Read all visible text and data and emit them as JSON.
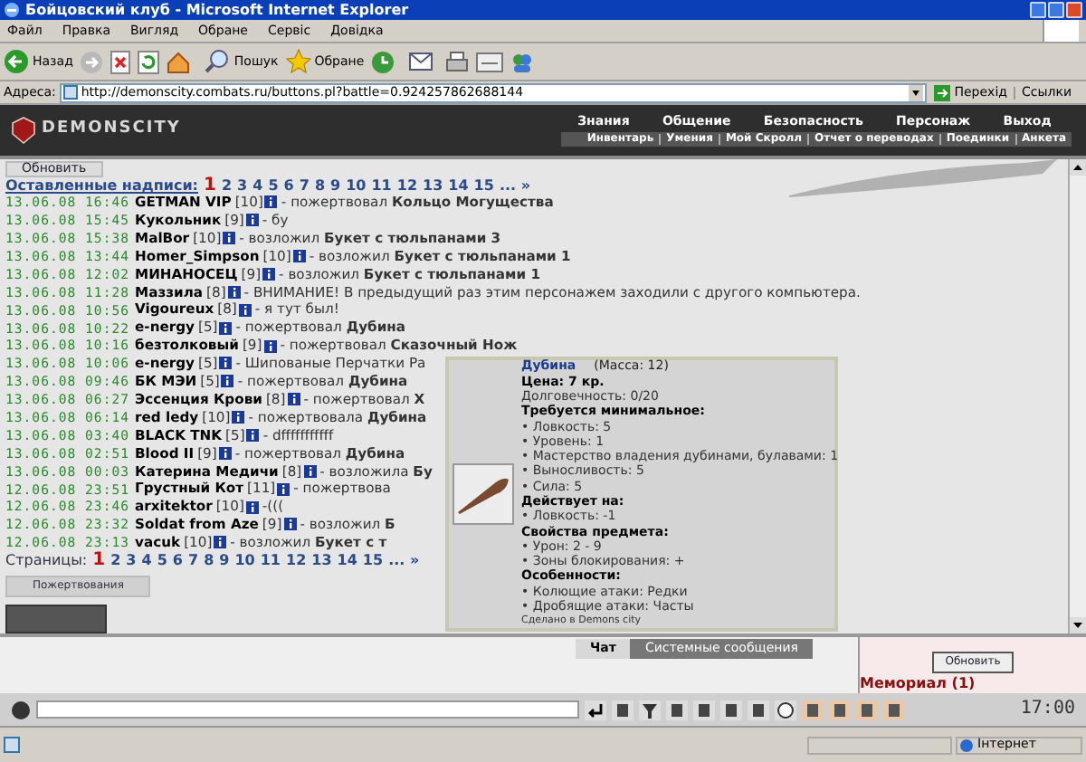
{
  "window": {
    "title": "Бойцовский клуб - Microsoft Internet Explorer"
  },
  "menu": [
    "Файл",
    "Правка",
    "Вигляд",
    "Обране",
    "Сервіс",
    "Довідка"
  ],
  "toolbar": {
    "back": "Назад",
    "search": "Пошук",
    "favorites": "Обране"
  },
  "address_bar": {
    "label": "Адреса:",
    "url": "http://demonscity.combats.ru/buttons.pl?battle=0.924257862688144",
    "go": "Перехід",
    "links": "Ссылки"
  },
  "site_header": {
    "logo": "DEMONSCITY",
    "nav_top": [
      "Знания",
      "Общение",
      "Безопасность",
      "Персонаж",
      "Выход"
    ],
    "nav_bottom": [
      "Инвентарь",
      "Умения",
      "Мой Скролл",
      "Отчет о переводах",
      "Поединки",
      "Анкета"
    ]
  },
  "refresh_button": "Обновить",
  "pager_top": {
    "label": "Оставленные надписи:",
    "pages": [
      {
        "label": "1",
        "selected": true
      },
      {
        "label": "2",
        "selected": false
      },
      {
        "label": "3",
        "selected": false
      },
      {
        "label": "4",
        "selected": false
      },
      {
        "label": "5",
        "selected": false
      },
      {
        "label": "6",
        "selected": false
      },
      {
        "label": "7",
        "selected": false
      },
      {
        "label": "8",
        "selected": false
      },
      {
        "label": "9",
        "selected": false
      },
      {
        "label": "10",
        "selected": false
      },
      {
        "label": "11",
        "selected": false
      },
      {
        "label": "12",
        "selected": false
      },
      {
        "label": "13",
        "selected": false
      },
      {
        "label": "14",
        "selected": false
      },
      {
        "label": "15",
        "selected": false
      }
    ],
    "more": "... »"
  },
  "rows": [
    {
      "time": "13.06.08 16:46",
      "nick": "GETMAN VIP",
      "level": "[10]",
      "message": "- пожертвовал **Кольцо Могущества**"
    },
    {
      "time": "13.06.08 15:45",
      "nick": "Кукольник",
      "level": "[9]",
      "message": "- бу"
    },
    {
      "time": "13.06.08 15:38",
      "nick": "MalBor",
      "level": "[10]",
      "message": "- возложил **Букет с тюльпанами 3**"
    },
    {
      "time": "13.06.08 13:44",
      "nick": "Homer_Simpson",
      "level": "[10]",
      "message": "- возложил **Букет с тюльпанами 1**"
    },
    {
      "time": "13.06.08 12:02",
      "nick": "МИНАНОСЕЦ",
      "level": "[9]",
      "message": "- возложил **Букет с тюльпанами 1**"
    },
    {
      "time": "13.06.08 11:28",
      "nick": "Маззила",
      "level": "[8]",
      "message": "- ВНИМАНИЕ! В предыдущий раз этим персонажем заходили с другого компьютера."
    },
    {
      "time": "13.06.08 10:56",
      "nick": "Vigoureux",
      "level": "[8]",
      "message": "- я тут был!"
    },
    {
      "time": "13.06.08 10:22",
      "nick": "e-nergy",
      "level": "[5]",
      "message": "- пожертвовал **Дубина**"
    },
    {
      "time": "13.06.08 10:16",
      "nick": "безтолковый",
      "level": "[9]",
      "message": "- пожертвовал **Сказочный Нож**"
    },
    {
      "time": "13.06.08 10:06",
      "nick": "e-nergy",
      "level": "[5]",
      "message": "- Шипованые Перчатки Ра"
    },
    {
      "time": "13.06.08 09:46",
      "nick": "БК МЭИ",
      "level": "[5]",
      "message": "- пожертвовал **Дубина**"
    },
    {
      "time": "13.06.08 06:27",
      "nick": "Эссенция Крови",
      "level": "[8]",
      "message": "- пожертвовал **Х**"
    },
    {
      "time": "13.06.08 06:14",
      "nick": "red ledy",
      "level": "[10]",
      "message": "- пожертвовала **Дубина**"
    },
    {
      "time": "13.06.08 03:40",
      "nick": "BLACK TNK",
      "level": "[5]",
      "message": "- dfffffffffff"
    },
    {
      "time": "13.06.08 02:51",
      "nick": "Blood II",
      "level": "[9]",
      "message": "- пожертвовал **Дубина**"
    },
    {
      "time": "13.06.08 00:03",
      "nick": "Катерина Медичи",
      "level": "[8]",
      "message": "- возложила **Бу**"
    },
    {
      "time": "12.06.08 23:51",
      "nick": "Грустный Кот",
      "level": "[11]",
      "message": "- пожертвова"
    },
    {
      "time": "12.06.08 23:46",
      "nick": "arxitektor",
      "level": "[10]",
      "message": "-((("
    },
    {
      "time": "12.06.08 23:32",
      "nick": "Soldat from Aze",
      "level": "[9]",
      "message": "- возложил **Б**"
    },
    {
      "time": "12.06.08 23:13",
      "nick": "vacuk",
      "level": "[10]",
      "message": "- возложил **Букет с т**"
    }
  ],
  "pager_bottom": {
    "label": "Страницы:",
    "pages": [
      {
        "label": "1",
        "selected": true
      },
      {
        "label": "2",
        "selected": false
      },
      {
        "label": "3",
        "selected": false
      },
      {
        "label": "4",
        "selected": false
      },
      {
        "label": "5",
        "selected": false
      },
      {
        "label": "6",
        "selected": false
      },
      {
        "label": "7",
        "selected": false
      },
      {
        "label": "8",
        "selected": false
      },
      {
        "label": "9",
        "selected": false
      },
      {
        "label": "10",
        "selected": false
      },
      {
        "label": "11",
        "selected": false
      },
      {
        "label": "12",
        "selected": false
      },
      {
        "label": "13",
        "selected": false
      },
      {
        "label": "14",
        "selected": false
      },
      {
        "label": "15",
        "selected": false
      }
    ],
    "more": "... »"
  },
  "donations_button": "Пожертвования",
  "tooltip": {
    "name": "Дубина",
    "mass": "(Масса: 12)",
    "lines": [
      {
        "kind": "strong",
        "text": "Цена: 7 кр."
      },
      {
        "kind": "text",
        "text": "Долговечность: 0/20"
      },
      {
        "kind": "heading",
        "text": "Требуется минимальное:"
      },
      {
        "kind": "text",
        "text": "• Ловкость: 5"
      },
      {
        "kind": "text",
        "text": "• Уровень: 1"
      },
      {
        "kind": "text",
        "text": "• Мастерство владения дубинами, булавами: 1"
      },
      {
        "kind": "text",
        "text": "• Выносливость: 5"
      },
      {
        "kind": "text",
        "text": "• Сила: 5"
      },
      {
        "kind": "heading",
        "text": "Действует на:"
      },
      {
        "kind": "text",
        "text": "• Ловкость: -1"
      },
      {
        "kind": "heading",
        "text": "Свойства предмета:"
      },
      {
        "kind": "text",
        "text": "• Урон: 2 - 9"
      },
      {
        "kind": "text",
        "text": "• Зоны блокирования: +"
      },
      {
        "kind": "heading",
        "text": "Особенности:"
      },
      {
        "kind": "text",
        "text": "• Колющие атаки: Редки"
      },
      {
        "kind": "text",
        "text": "• Дробящие атаки: Часты"
      },
      {
        "kind": "small",
        "text": "Сделано в Demons city"
      }
    ]
  },
  "chat_tabs": [
    {
      "label": "Чат",
      "selected": true
    },
    {
      "label": "Системные сообщения",
      "selected": false
    }
  ],
  "side_panel": {
    "button": "Обновить",
    "memorial": "Мемориал (1)"
  },
  "clock": "17:00",
  "status_bar": {
    "zone": "Інтернет"
  }
}
